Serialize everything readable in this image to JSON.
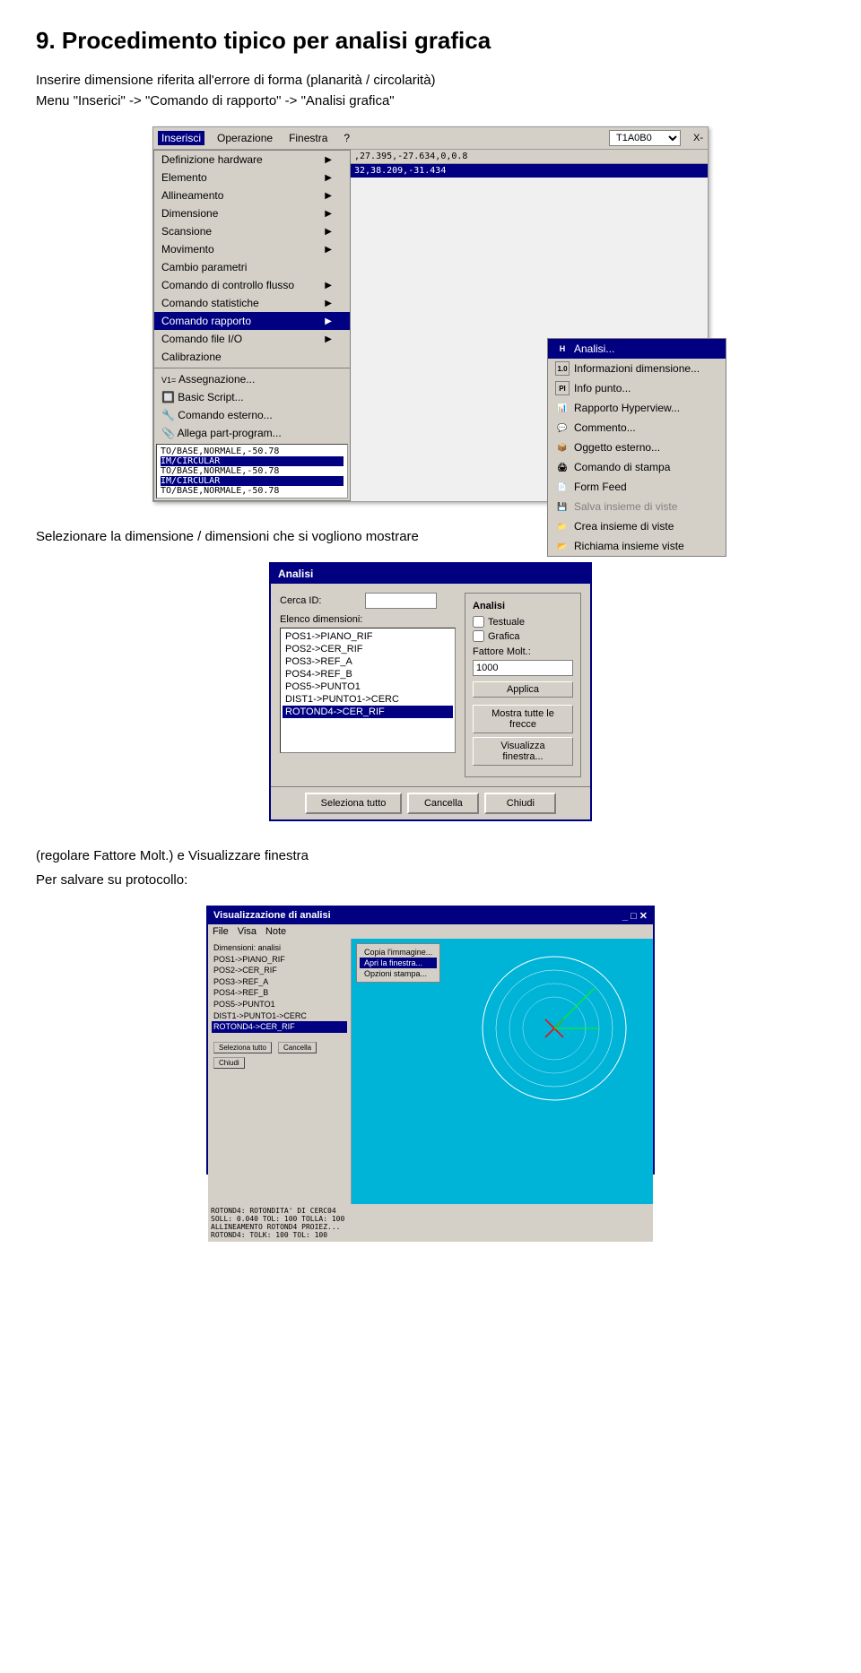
{
  "page": {
    "title": "9. Procedimento tipico per analisi grafica",
    "intro1": "Inserire dimensione riferita all'errore di forma (planarità / circolarità)",
    "intro2": "Menu \"Inserici\" -> \"Comando di rapporto\" -> \"Analisi grafica\"",
    "section1": "Selezionare la dimensione / dimensioni che si vogliono mostrare",
    "note1": "(regolare Fattore Molt.) e Visualizzare finestra",
    "note2": "Per salvare su protocollo:"
  },
  "menu": {
    "bar_items": [
      "Inserisci",
      "Operazione",
      "Finestra",
      "?"
    ],
    "primary_items": [
      {
        "label": "Definizione hardware",
        "has_arrow": true
      },
      {
        "label": "Elemento",
        "has_arrow": true
      },
      {
        "label": "Allineamento",
        "has_arrow": true
      },
      {
        "label": "Dimensione",
        "has_arrow": true
      },
      {
        "label": "Scansione",
        "has_arrow": true
      },
      {
        "label": "Movimento",
        "has_arrow": true
      },
      {
        "label": "Cambio parametri",
        "has_arrow": false
      },
      {
        "label": "Comando di controllo flusso",
        "has_arrow": true
      },
      {
        "label": "Comando statistiche",
        "has_arrow": true
      },
      {
        "label": "Comando rapporto",
        "has_arrow": true,
        "active": true
      },
      {
        "label": "Comando file I/O",
        "has_arrow": true
      },
      {
        "label": "Calibrazione",
        "has_arrow": false
      },
      {
        "label": "Assegnazione...",
        "has_arrow": false,
        "prefix": "V1="
      },
      {
        "label": "Basic Script...",
        "has_arrow": false
      },
      {
        "label": "Comando esterno...",
        "has_arrow": false
      },
      {
        "label": "Allega part-program...",
        "has_arrow": false
      }
    ],
    "submenu_items": [
      {
        "label": "Analisi...",
        "icon": "H",
        "active": true
      },
      {
        "label": "Informazioni dimensione...",
        "icon": "1.0"
      },
      {
        "label": "Info punto...",
        "icon": "PI"
      },
      {
        "label": "Rapporto Hyperview...",
        "icon": ""
      },
      {
        "label": "Commento...",
        "icon": ""
      },
      {
        "label": "Oggetto esterno...",
        "icon": ""
      },
      {
        "label": "Comando di stampa",
        "icon": ""
      },
      {
        "label": "Form Feed",
        "icon": ""
      },
      {
        "label": "Salva insieme di viste",
        "icon": "",
        "disabled": true
      },
      {
        "label": "Crea insieme di viste",
        "icon": ""
      },
      {
        "label": "Richiama insieme viste",
        "icon": ""
      }
    ],
    "code_lines": [
      "TO/BASE,NORMALE,-50.78",
      "IM/CIRCULAR",
      "TO/BASE,NORMALE,-50.78",
      "IM/CIRCULAR",
      "TO/BASE,NORMALE,-50.78"
    ],
    "dropdown_value": "T1A0B0",
    "coord_text1": ",27.395,-27.634,0,0.8",
    "coord_text2": "32,38.209,-31.434"
  },
  "analisi_dialog": {
    "title": "Analisi",
    "cerca_id_label": "Cerca ID:",
    "elenco_label": "Elenco dimensioni:",
    "list_items": [
      "POS1->PIANO_RIF",
      "POS2->CER_RIF",
      "POS3->REF_A",
      "POS4->REF_B",
      "POS5->PUNTO1",
      "DIST1->PUNTO1->CERC",
      "ROTOND4->CER_RIF"
    ],
    "selected_item": "ROTOND4->CER_RIF",
    "right_panel_title": "Analisi",
    "checkbox_testuale": "Testuale",
    "checkbox_grafica": "Grafica",
    "fattore_molt_label": "Fattore Molt.:",
    "fattore_value": "1000",
    "apply_btn": "Applica",
    "mostra_btn": "Mostra tutte le frecce",
    "visualizza_btn": "Visualizza finestra...",
    "seleziona_btn": "Seleziona tutto",
    "cancella_btn": "Cancella",
    "chiudi_btn": "Chiudi"
  },
  "protocol_window": {
    "title": "Visualizzazione di analisi",
    "menu_items": [
      "File",
      "Visa",
      "Note"
    ],
    "submenu_items": [
      "Copia l'immagine...",
      "Apri la finestra...",
      "Opzioni stampa..."
    ],
    "data_lines": [
      "ROTOND4: ROTONDITA' DI CERC04",
      "SOLL: 0.040 TOL: 100 TOLLA: 100",
      "ALLINEAMENTO ROTOND4 PROIEZ...",
      "ROTOND4: TOLK: 100 TOL: 100"
    ]
  },
  "icons": {
    "arrow_right": "▶",
    "checkbox_empty": "☐",
    "checkbox_checked": "☑"
  }
}
